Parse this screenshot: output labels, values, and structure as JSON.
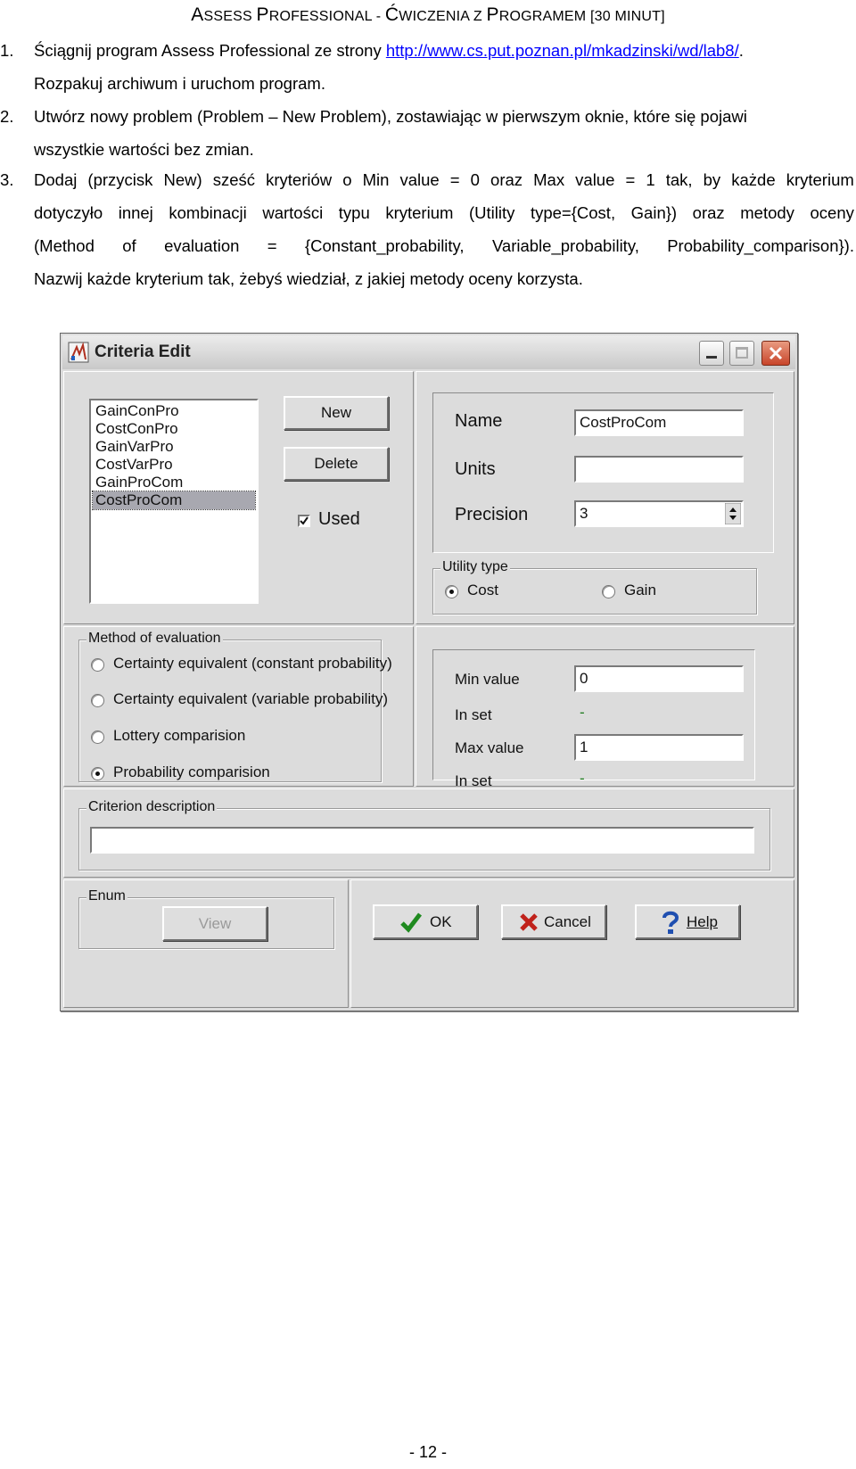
{
  "document": {
    "title_parts": [
      "A",
      "SSESS ",
      "P",
      "ROFESSIONAL - ",
      "Ć",
      "WICZENIA Z ",
      "P",
      "ROGRAMEM [30 ",
      "MINUT]"
    ],
    "steps": [
      {
        "num": "1.",
        "lines": [
          "Ściągnij program Assess Professional ze strony ",
          "http://www.cs.put.poznan.pl/mkadzinski/wd/lab8/",
          ".",
          "Rozpakuj archiwum i uruchom program."
        ]
      },
      {
        "num": "2.",
        "lines": [
          "Utwórz nowy problem (Problem – New Problem), zostawiając w pierwszym oknie, które się pojawi",
          "wszystkie wartości bez zmian."
        ]
      },
      {
        "num": "3.",
        "lines": [
          [
            "Dodaj",
            "(przycisk",
            "New)",
            "sześć",
            "kryteriów",
            "o",
            "Min",
            "value",
            "=",
            "0",
            "oraz",
            "Max",
            "value",
            "=",
            "1",
            "tak,",
            "by",
            "każde",
            "kryterium"
          ],
          [
            "dotyczyło",
            "innej",
            "kombinacji",
            "wartości",
            "typu",
            "kryterium",
            "(Utility",
            "type={Cost,",
            "Gain})",
            "oraz",
            "metody",
            "oceny"
          ],
          [
            "(Method",
            "of",
            "evaluation",
            "=",
            "{Constant_probability,",
            "Variable_probability,",
            "Probability_comparison})."
          ],
          "Nazwij każde kryterium tak, żebyś wiedział, z jakiej metody oceny korzysta."
        ]
      }
    ],
    "page_number": "- 12 -"
  },
  "dialog": {
    "title": "Criteria Edit",
    "criteria_list": [
      "GainConPro",
      "CostConPro",
      "GainVarPro",
      "CostVarPro",
      "GainProCom",
      "CostProCom"
    ],
    "selected_criterion": "CostProCom",
    "new_label": "New",
    "delete_label": "Delete",
    "used_label": "Used",
    "used_checked": true,
    "name_label": "Name",
    "name_value": "CostProCom",
    "units_label": "Units",
    "units_value": "",
    "precision_label": "Precision",
    "precision_value": "3",
    "utility_type": {
      "legend": "Utility type",
      "options": [
        "Cost",
        "Gain"
      ],
      "selected": "Cost"
    },
    "method": {
      "legend": "Method of evaluation",
      "options": [
        "Certainty equivalent (constant probability)",
        "Certainty equivalent (variable probability)",
        "Lottery comparision",
        "Probability comparision"
      ],
      "selected": "Probability comparision"
    },
    "min_value_label": "Min value",
    "min_value": "0",
    "in_set_label": "In set",
    "in_set_min": "-",
    "max_value_label": "Max value",
    "max_value": "1",
    "in_set_max": "-",
    "criterion_description_legend": "Criterion description",
    "criterion_description_value": "",
    "enum_legend": "Enum",
    "view_label": "View",
    "ok_label": "OK",
    "cancel_label": "Cancel",
    "help_label": "Help",
    "colors": {
      "accent_check": "#1f8a1f",
      "cancel_x": "#c0221b",
      "help": "#1f4fb0"
    }
  }
}
